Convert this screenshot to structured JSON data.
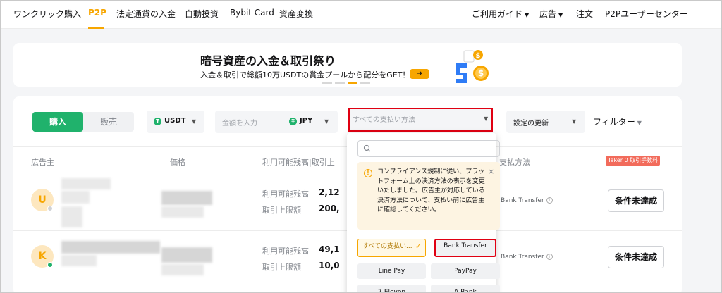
{
  "nav": {
    "left": [
      "ワンクリック購入",
      "P2P",
      "法定通貨の入金",
      "自動投資",
      "Bybit Card",
      "資産変換"
    ],
    "right": [
      "ご利用ガイド",
      "広告",
      "注文",
      "P2Pユーザーセンター"
    ],
    "active": "P2P"
  },
  "banner": {
    "title": "暗号資産の入金＆取引祭り",
    "subtitle": "入金＆取引で総額10万USDTの賞金プールから配分をGET！",
    "arrow": "➔"
  },
  "filters": {
    "buy_label": "購入",
    "sell_label": "販売",
    "coin": "USDT",
    "coin_icon": "₮",
    "amount_placeholder": "金額を入力",
    "fiat": "JPY",
    "fiat_icon": "¥",
    "payment_placeholder": "すべての支払い方法",
    "refresh": "設定の更新",
    "filter": "フィルター"
  },
  "table": {
    "headers": {
      "advertiser": "広告主",
      "price": "価格",
      "available": "利用可能残高|取引上",
      "payment": "支払方法"
    },
    "taker_badge": "Taker 0 取引手数料",
    "rows": [
      {
        "avatar": "U",
        "avail_label": "利用可能残高",
        "avail_value": "2,12",
        "limit_label": "取引上限額",
        "limit_value": "200,",
        "payment": "Bank Transfer",
        "action": "条件未達成",
        "status_color": "#d0d2d6"
      },
      {
        "avatar": "K",
        "avail_label": "利用可能残高",
        "avail_value": "49,1",
        "limit_label": "取引上限額",
        "limit_value": "10,0",
        "payment": "Bank Transfer",
        "action": "条件未達成",
        "status_color": "#20b26c"
      }
    ]
  },
  "dropdown": {
    "notice": "コンプライアンス規制に従い、プラットフォーム上の決済方法の表示を変更いたしました。広告主が対応している決済方法について、支払い前に広告主に確認してください。",
    "close": "×",
    "options": [
      "すべての支払い...",
      "Bank Transfer",
      "Line Pay",
      "PayPay",
      "7-Eleven",
      "A-Bank"
    ]
  },
  "colors": {
    "accent": "#f7a600",
    "buy": "#20b26c",
    "highlight": "#e00012"
  }
}
